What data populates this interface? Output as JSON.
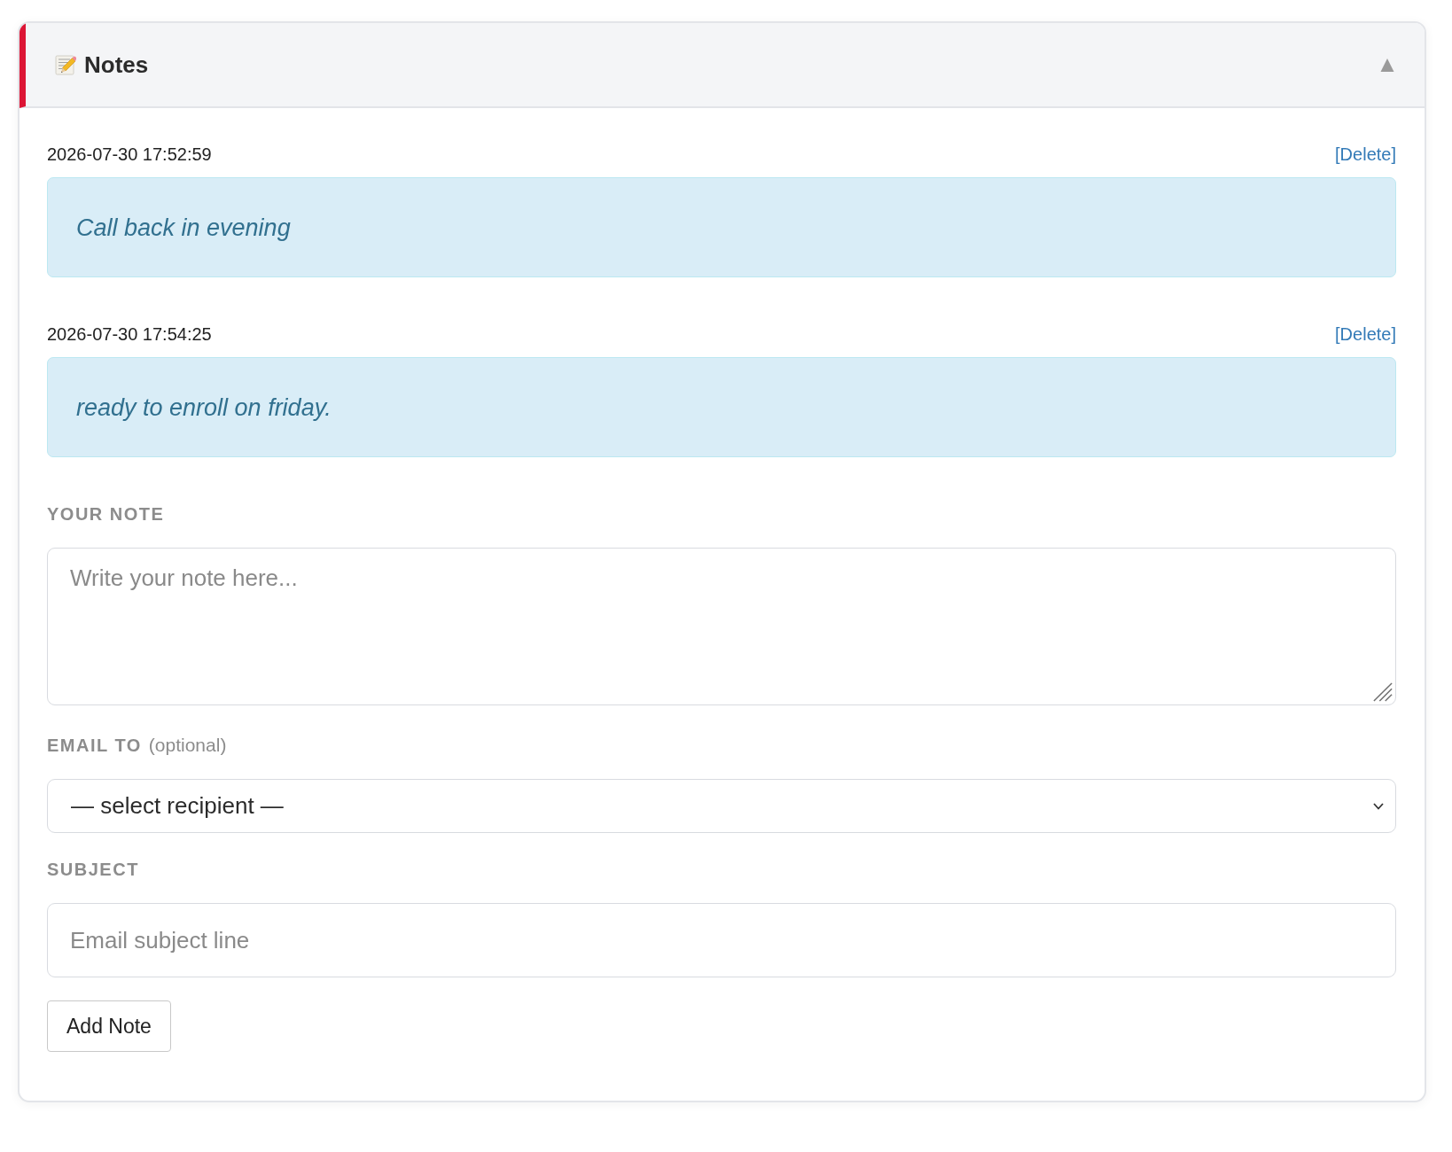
{
  "panel": {
    "title": "Notes",
    "expanded": true
  },
  "notes": [
    {
      "timestamp": "2026-07-30 17:52:59",
      "action": "[Delete]",
      "text": "Call back in evening"
    },
    {
      "timestamp": "2026-07-30 17:54:25",
      "action": "[Delete]",
      "text": "ready to enroll on friday."
    }
  ],
  "form": {
    "note": {
      "label": "YOUR NOTE",
      "placeholder": "Write your note here..."
    },
    "email_to": {
      "label": "EMAIL TO",
      "hint": "(optional)",
      "value": "— select recipient —"
    },
    "subject": {
      "label": "SUBJECT",
      "placeholder": "Email subject line"
    },
    "submit": "Add Note"
  }
}
